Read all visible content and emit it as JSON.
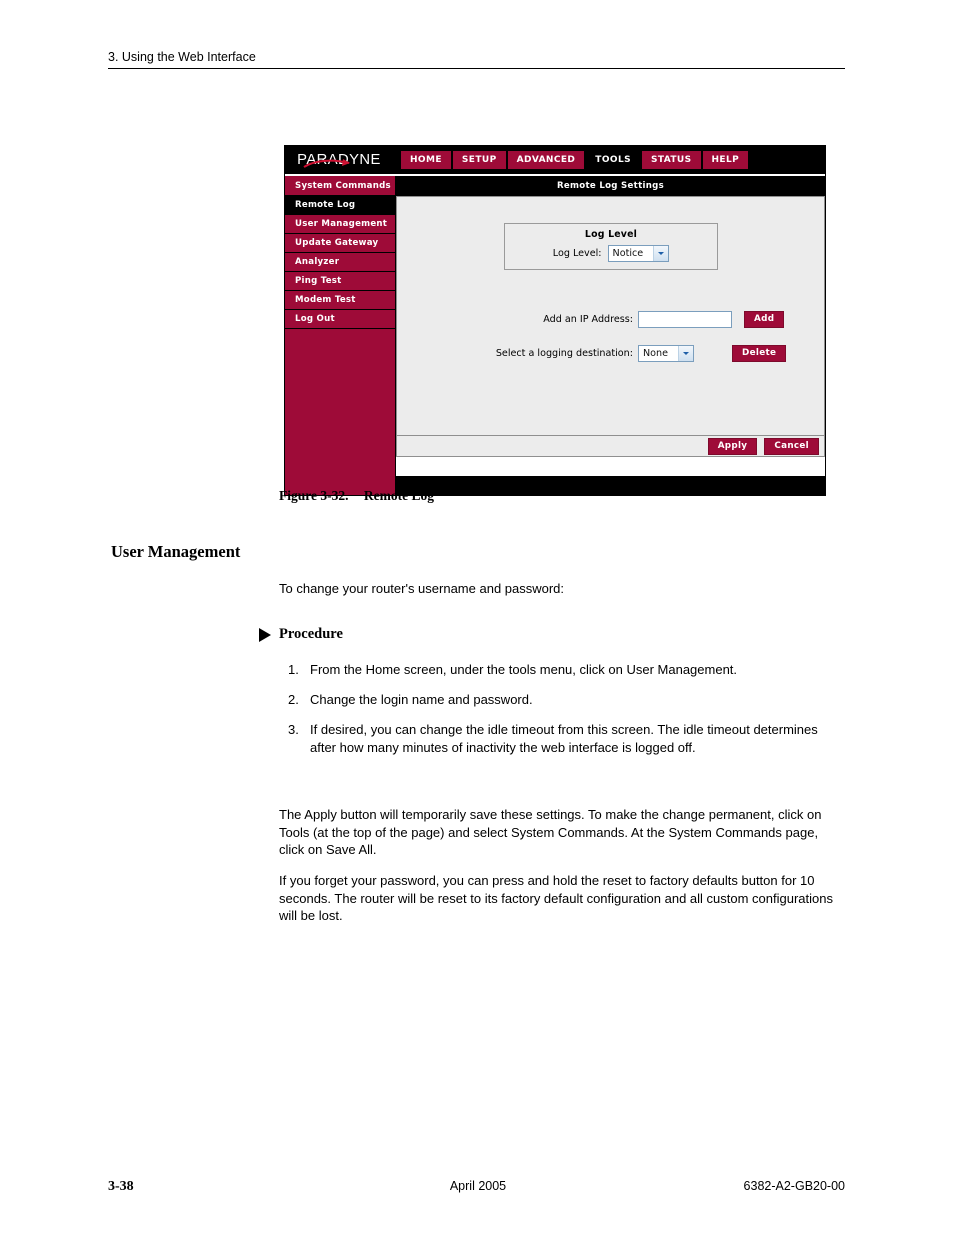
{
  "page": {
    "running_header": "3. Using the Web Interface",
    "footer": {
      "page_number": "3-38",
      "date": "April 2005",
      "doc_number": "6382-A2-GB20-00"
    }
  },
  "figure": {
    "caption_label": "Figure 3-32.",
    "caption_title": "Remote Log"
  },
  "router_ui": {
    "logo": "PARADYNE",
    "tabs": [
      {
        "label": "HOME",
        "active": false
      },
      {
        "label": "SETUP",
        "active": false
      },
      {
        "label": "ADVANCED",
        "active": false
      },
      {
        "label": "TOOLS",
        "active": true
      },
      {
        "label": "STATUS",
        "active": false
      },
      {
        "label": "HELP",
        "active": false
      }
    ],
    "sidebar": [
      {
        "label": "System Commands",
        "active": false
      },
      {
        "label": "Remote Log",
        "active": true
      },
      {
        "label": "User Management",
        "active": false
      },
      {
        "label": "Update Gateway",
        "active": false
      },
      {
        "label": "Analyzer",
        "active": false
      },
      {
        "label": "Ping Test",
        "active": false
      },
      {
        "label": "Modem Test",
        "active": false
      },
      {
        "label": "Log Out",
        "active": false
      }
    ],
    "content_title": "Remote Log Settings",
    "log_level_box": {
      "title": "Log Level",
      "field_label": "Log Level:",
      "value": "Notice"
    },
    "ip_row": {
      "label": "Add an IP Address:",
      "value": "",
      "placeholder": "",
      "button": "Add"
    },
    "destination_row": {
      "label": "Select a logging destination:",
      "value": "None",
      "button": "Delete"
    },
    "footer_buttons": {
      "apply": "Apply",
      "cancel": "Cancel"
    },
    "colors": {
      "brand_crimson": "#9e0b38",
      "header_black": "#000000",
      "panel_gray": "#ececec"
    }
  },
  "body": {
    "section_heading": "User Management",
    "intro": "To change your router's username and password:",
    "procedure_label": "Procedure",
    "steps": [
      {
        "num": "1.",
        "text": "From the Home screen, under the tools menu, click on User Management."
      },
      {
        "num": "2.",
        "text": "Change the login name and password."
      },
      {
        "num": "3.",
        "text": "If desired, you can change the idle timeout from this screen. The idle timeout determines after how many minutes of inactivity the web interface is logged off."
      }
    ],
    "paragraph_1": "The Apply button will temporarily save these settings. To make the change permanent,  click on Tools (at the top of the page) and select System Commands. At the System Commands page, click on Save All.",
    "paragraph_2": "If you forget your password, you can press and hold the reset to factory defaults button for 10 seconds. The router will be reset to its factory default configuration and all custom configurations will be lost."
  }
}
